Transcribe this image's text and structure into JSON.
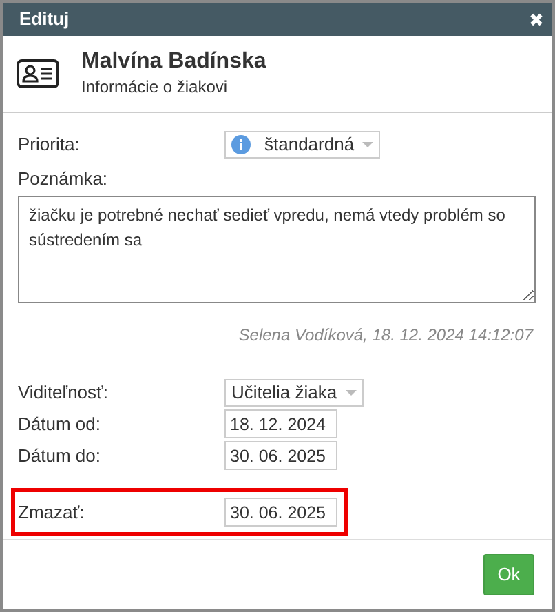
{
  "window": {
    "title": "Edituj",
    "close": "✖"
  },
  "header": {
    "name": "Malvína Badínska",
    "subtitle": "Informácie o žiakovi"
  },
  "priority": {
    "label": "Priorita:",
    "value": "štandardná"
  },
  "note": {
    "label": "Poznámka:",
    "value": "žiačku je potrebné nechať sedieť vpredu, nemá vtedy problém so sústredením sa"
  },
  "author": "Selena Vodíková, 18. 12. 2024 14:12:07",
  "fields": [
    {
      "kind": "select",
      "label": "Viditeľnosť:",
      "value": "Učitelia žiaka",
      "highlighted": false
    },
    {
      "kind": "date",
      "label": "Dátum od:",
      "value": "18. 12. 2024",
      "highlighted": false
    },
    {
      "kind": "date",
      "label": "Dátum do:",
      "value": "30. 06. 2025",
      "highlighted": false
    },
    {
      "kind": "date",
      "label": "Zmazať:",
      "value": "30. 06. 2025",
      "highlighted": true
    }
  ],
  "buttons": [
    "Ok"
  ]
}
